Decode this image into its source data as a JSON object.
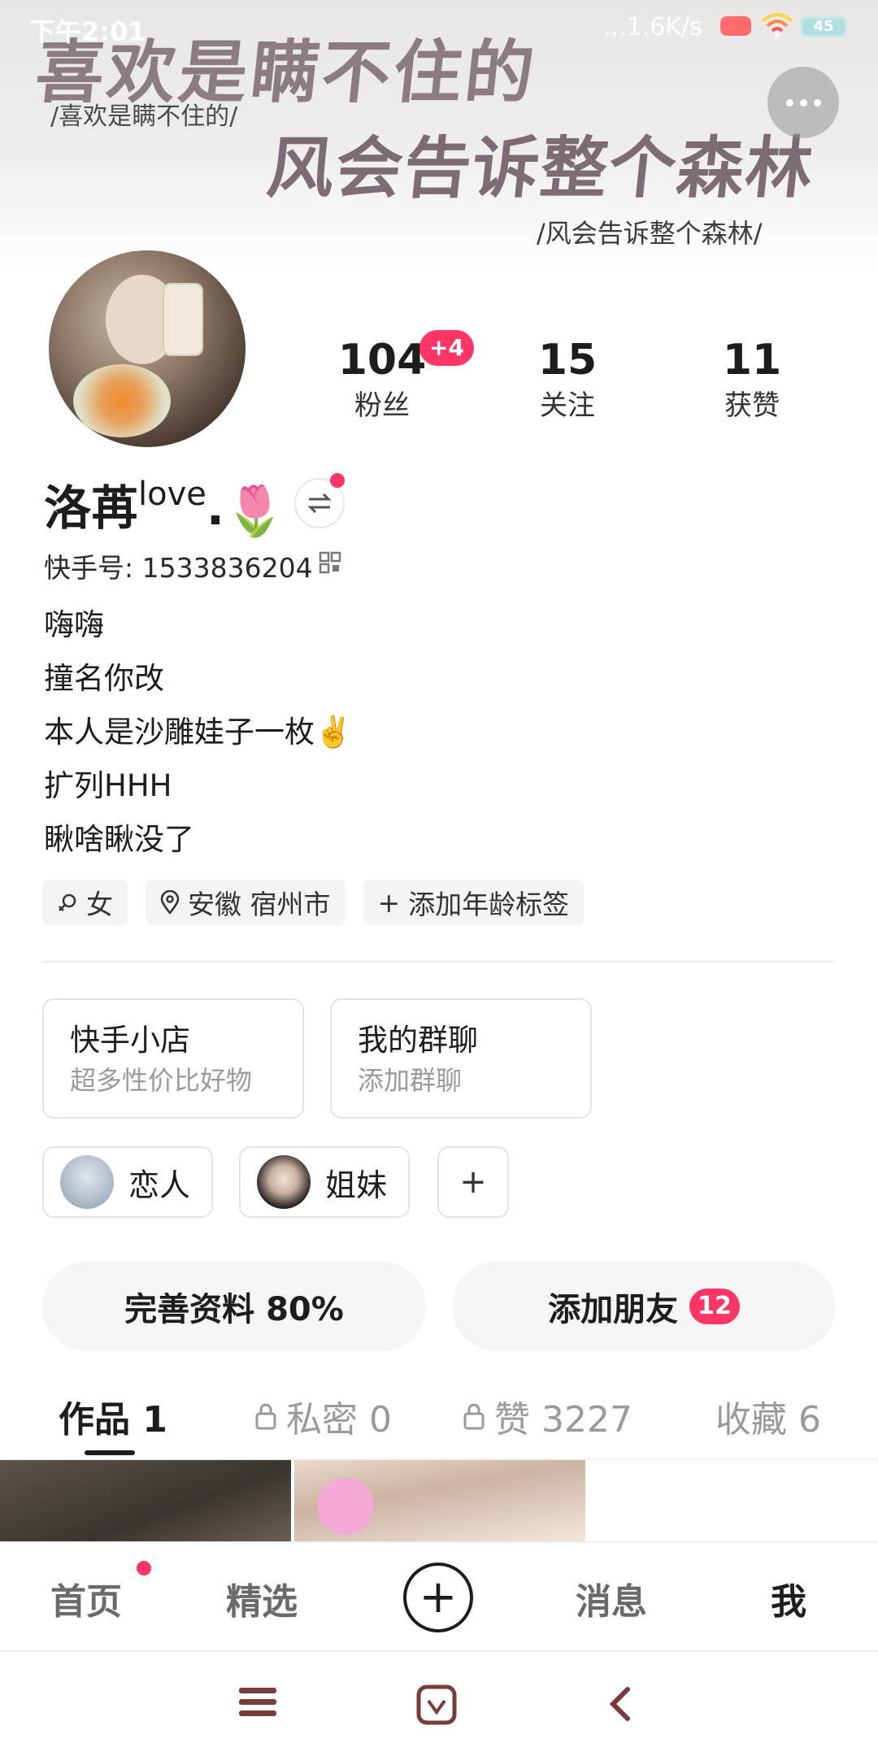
{
  "status_bar": {
    "time": "下午2:01",
    "net_speed": "...1.6K/s",
    "battery": "45"
  },
  "banner": {
    "line1": "喜欢是瞒不住的",
    "line1_small": "/喜欢是瞒不住的/",
    "line2": "风会告诉整个森林",
    "line2_small": "/风会告诉整个森林/"
  },
  "stats": {
    "fans": {
      "value": "104",
      "label": "粉丝",
      "badge": "+4"
    },
    "following": {
      "value": "15",
      "label": "关注"
    },
    "likes": {
      "value": "11",
      "label": "获赞"
    }
  },
  "profile": {
    "name": "洛苒",
    "name_sup": "love",
    "name_suffix": ".",
    "id_label": "快手号: 1533836204",
    "bio": [
      "嗨嗨",
      "撞名你改",
      "本人是沙雕娃子一枚✌️",
      "扩列HHH",
      "瞅啥瞅没了"
    ]
  },
  "tags": {
    "gender": "女",
    "location": "安徽 宿州市",
    "add_age": "添加年龄标签"
  },
  "cards": {
    "shop": {
      "title": "快手小店",
      "subtitle": "超多性价比好物"
    },
    "group": {
      "title": "我的群聊",
      "subtitle": "添加群聊"
    }
  },
  "relations": {
    "lover": "恋人",
    "sister": "姐妹",
    "add": "+"
  },
  "actions": {
    "complete_profile": "完善资料 80%",
    "add_friends": "添加朋友",
    "add_friends_badge": "12"
  },
  "tabs": {
    "works": "作品 1",
    "private": "私密 0",
    "liked": "赞 3227",
    "favorites": "收藏 6"
  },
  "bottom_nav": {
    "home": "首页",
    "featured": "精选",
    "create": "+",
    "messages": "消息",
    "me": "我"
  },
  "colors": {
    "accent": "#fe3666",
    "text": "#1d1d1d",
    "muted": "#9a9a9a"
  }
}
